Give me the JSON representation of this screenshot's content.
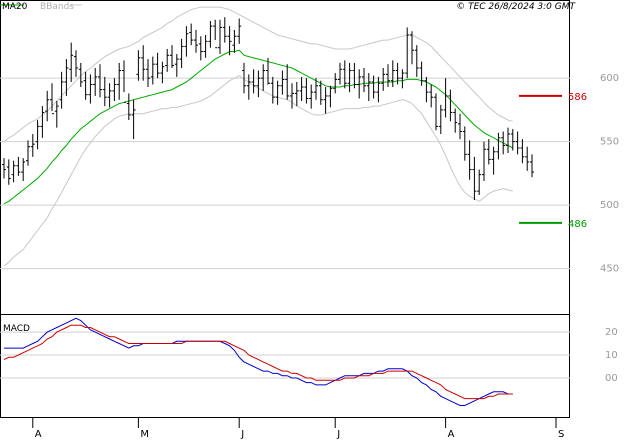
{
  "header": {
    "legend_ma": "MA20",
    "legend_bbands": "BBands",
    "copyright": "© TEC 26/8/2024 3:0 GMT"
  },
  "colors": {
    "ma": "#00aa00",
    "bbands": "#c8c8c8",
    "bars": "#000000",
    "grid": "#d0d0d0",
    "macd": "#0000cc",
    "signal": "#cc0000",
    "resistance": "#cc0000",
    "support": "#009900"
  },
  "chart_data": [
    {
      "type": "ohlc",
      "panel": "price",
      "ylim": [
        415,
        660
      ],
      "y_ticks": [
        450,
        500,
        550,
        600
      ],
      "x_ticks": [
        {
          "label": "A",
          "index": 6
        },
        {
          "label": "M",
          "index": 28
        },
        {
          "label": "J",
          "index": 49
        },
        {
          "label": "J",
          "index": 69
        },
        {
          "label": "A",
          "index": 92
        },
        {
          "label": "S",
          "index": 115
        }
      ],
      "levels": [
        {
          "name": "resistance",
          "value": 586,
          "label": "586"
        },
        {
          "name": "support",
          "value": 486,
          "label": "486"
        }
      ],
      "bars": [
        [
          532,
          537,
          521,
          528
        ],
        [
          530,
          536,
          516,
          521
        ],
        [
          524,
          535,
          518,
          531
        ],
        [
          531,
          538,
          523,
          526
        ],
        [
          526,
          537,
          519,
          534
        ],
        [
          535,
          551,
          531,
          546
        ],
        [
          546,
          556,
          538,
          548
        ],
        [
          550,
          567,
          544,
          562
        ],
        [
          562,
          578,
          553,
          573
        ],
        [
          574,
          590,
          566,
          583
        ],
        [
          583,
          596,
          574,
          572
        ],
        [
          574,
          582,
          561,
          578
        ],
        [
          583,
          605,
          576,
          597
        ],
        [
          597,
          615,
          586,
          608
        ],
        [
          607,
          628,
          597,
          618
        ],
        [
          617,
          622,
          601,
          608
        ],
        [
          607,
          612,
          593,
          597
        ],
        [
          598,
          605,
          583,
          587
        ],
        [
          587,
          603,
          580,
          595
        ],
        [
          595,
          608,
          586,
          601
        ],
        [
          601,
          611,
          585,
          591
        ],
        [
          591,
          601,
          578,
          585
        ],
        [
          585,
          596,
          577,
          590
        ],
        [
          590,
          600,
          582,
          595
        ],
        [
          595,
          612,
          583,
          606
        ],
        [
          606,
          614,
          589,
          581
        ],
        [
          580,
          588,
          567,
          571
        ],
        [
          571,
          583,
          552,
          575
        ],
        [
          603,
          622,
          598,
          616
        ],
        [
          616,
          626,
          598,
          607
        ],
        [
          607,
          615,
          593,
          600
        ],
        [
          601,
          617,
          595,
          611
        ],
        [
          611,
          620,
          600,
          604
        ],
        [
          604,
          613,
          596,
          609
        ],
        [
          610,
          623,
          605,
          618
        ],
        [
          618,
          626,
          608,
          610
        ],
        [
          611,
          619,
          601,
          615
        ],
        [
          615,
          631,
          608,
          625
        ],
        [
          625,
          641,
          617,
          635
        ],
        [
          636,
          643,
          626,
          630
        ],
        [
          630,
          638,
          620,
          626
        ],
        [
          627,
          633,
          614,
          621
        ],
        [
          621,
          634,
          616,
          629
        ],
        [
          629,
          645,
          624,
          641
        ],
        [
          641,
          646,
          630,
          624
        ],
        [
          624,
          646,
          619,
          640
        ],
        [
          640,
          648,
          628,
          633
        ],
        [
          633,
          641,
          618,
          629
        ],
        [
          626,
          638,
          620,
          633
        ],
        [
          633,
          647,
          627,
          641
        ],
        [
          606,
          612,
          588,
          594
        ],
        [
          594,
          603,
          583,
          597
        ],
        [
          597,
          607,
          588,
          594
        ],
        [
          594,
          606,
          585,
          600
        ],
        [
          600,
          611,
          590,
          606
        ],
        [
          606,
          616,
          595,
          596
        ],
        [
          596,
          601,
          580,
          585
        ],
        [
          585,
          598,
          579,
          594
        ],
        [
          594,
          606,
          587,
          599
        ],
        [
          599,
          611,
          583,
          586
        ],
        [
          586,
          596,
          576,
          588
        ],
        [
          588,
          597,
          578,
          590
        ],
        [
          590,
          601,
          582,
          593
        ],
        [
          593,
          600,
          580,
          584
        ],
        [
          584,
          595,
          576,
          589
        ],
        [
          589,
          600,
          583,
          594
        ],
        [
          594,
          598,
          579,
          583
        ],
        [
          583,
          593,
          572,
          586
        ],
        [
          586,
          594,
          577,
          592
        ],
        [
          592,
          604,
          588,
          599
        ],
        [
          599,
          612,
          595,
          607
        ],
        [
          607,
          614,
          592,
          596
        ],
        [
          596,
          612,
          589,
          606
        ],
        [
          606,
          612,
          592,
          595
        ],
        [
          595,
          607,
          584,
          601
        ],
        [
          601,
          608,
          589,
          594
        ],
        [
          594,
          604,
          582,
          597
        ],
        [
          597,
          602,
          584,
          589
        ],
        [
          589,
          601,
          581,
          596
        ],
        [
          596,
          608,
          590,
          603
        ],
        [
          603,
          611,
          593,
          598
        ],
        [
          598,
          614,
          593,
          606
        ],
        [
          606,
          612,
          595,
          600
        ],
        [
          600,
          607,
          592,
          604
        ],
        [
          604,
          640,
          600,
          634
        ],
        [
          634,
          637,
          611,
          622
        ],
        [
          622,
          626,
          601,
          608
        ],
        [
          608,
          613,
          594,
          598
        ],
        [
          598,
          601,
          581,
          589
        ],
        [
          589,
          595,
          577,
          585
        ],
        [
          585,
          588,
          559,
          562
        ],
        [
          562,
          579,
          556,
          575
        ],
        [
          575,
          600,
          569,
          586
        ],
        [
          586,
          591,
          566,
          573
        ],
        [
          573,
          576,
          557,
          565
        ],
        [
          564,
          572,
          552,
          558
        ],
        [
          558,
          562,
          535,
          540
        ],
        [
          540,
          551,
          520,
          528
        ],
        [
          528,
          538,
          504,
          511
        ],
        [
          511,
          528,
          508,
          524
        ],
        [
          524,
          550,
          519,
          544
        ],
        [
          544,
          552,
          532,
          536
        ],
        [
          536,
          546,
          524,
          542
        ],
        [
          542,
          557,
          536,
          553
        ],
        [
          553,
          558,
          540,
          547
        ],
        [
          547,
          561,
          541,
          556
        ],
        [
          556,
          560,
          543,
          550
        ],
        [
          550,
          558,
          540,
          545
        ],
        [
          545,
          552,
          533,
          538
        ],
        [
          538,
          546,
          527,
          534
        ],
        [
          534,
          540,
          522,
          526
        ]
      ],
      "series": [
        {
          "name": "MA20",
          "values": [
            501,
            503,
            506,
            509,
            512,
            515,
            518,
            521,
            525,
            529,
            534,
            538,
            543,
            547,
            552,
            556,
            560,
            563,
            566,
            569,
            572,
            574,
            576,
            578,
            580,
            581,
            582,
            583,
            584,
            585,
            586,
            587,
            588,
            589,
            590,
            591,
            593,
            595,
            597,
            600,
            603,
            606,
            609,
            612,
            615,
            617,
            619,
            621,
            621,
            622,
            618,
            617,
            616,
            615,
            614,
            613,
            612,
            611,
            610,
            609,
            608,
            606,
            604,
            602,
            600,
            598,
            596,
            594,
            593,
            593,
            593,
            594,
            594,
            595,
            595,
            596,
            596,
            596,
            597,
            597,
            597,
            597,
            598,
            598,
            599,
            599,
            599,
            598,
            597,
            595,
            593,
            590,
            587,
            583,
            579,
            575,
            571,
            567,
            563,
            560,
            557,
            555,
            553,
            551,
            549,
            547,
            545
          ]
        },
        {
          "name": "BBands",
          "values": [
            452,
            455,
            459,
            462,
            465,
            470,
            475,
            480,
            485,
            490,
            497,
            503,
            510,
            517,
            524,
            531,
            538,
            544,
            549,
            554,
            558,
            562,
            565,
            568,
            570,
            571,
            572,
            572,
            572,
            572,
            573,
            574,
            575,
            576,
            576,
            577,
            577,
            578,
            579,
            580,
            581,
            582,
            584,
            586,
            589,
            592,
            595,
            598,
            600,
            602,
            599,
            597,
            594,
            592,
            590,
            588,
            586,
            585,
            584,
            583,
            581,
            578,
            576,
            574,
            572,
            571,
            571,
            572,
            573,
            574,
            575,
            576,
            576,
            576,
            576,
            577,
            577,
            578,
            578,
            579,
            580,
            581,
            582,
            583,
            582,
            580,
            576,
            572,
            566,
            560,
            554,
            547,
            539,
            530,
            522,
            515,
            510,
            507,
            505,
            503,
            506,
            509,
            511,
            512,
            513,
            512,
            511
          ]
        },
        {
          "name": "BBands",
          "values": [
            550,
            553,
            555,
            558,
            561,
            564,
            566,
            568,
            571,
            574,
            578,
            582,
            586,
            590,
            594,
            598,
            602,
            605,
            608,
            611,
            614,
            617,
            619,
            621,
            623,
            624,
            625,
            627,
            629,
            632,
            634,
            636,
            638,
            640,
            643,
            645,
            648,
            650,
            652,
            654,
            655,
            656,
            656,
            656,
            656,
            656,
            655,
            654,
            652,
            650,
            648,
            646,
            644,
            642,
            640,
            638,
            636,
            634,
            633,
            632,
            631,
            630,
            629,
            628,
            627,
            627,
            626,
            625,
            624,
            623,
            623,
            623,
            623,
            624,
            625,
            626,
            627,
            628,
            629,
            630,
            630,
            631,
            632,
            633,
            634,
            634,
            632,
            630,
            628,
            625,
            621,
            617,
            613,
            609,
            605,
            601,
            597,
            593,
            589,
            585,
            581,
            577,
            574,
            571,
            569,
            567,
            566
          ]
        }
      ]
    },
    {
      "type": "line",
      "panel": "macd",
      "title": "MACD",
      "y_ticks": [
        {
          "label": "20",
          "value": 20
        },
        {
          "label": "10",
          "value": 10
        },
        {
          "label": "00",
          "value": 0
        }
      ],
      "ylim": [
        -17,
        27
      ],
      "series": [
        {
          "name": "MACD",
          "values": [
            13,
            13,
            13,
            13,
            13,
            14,
            15,
            16,
            18,
            20,
            21,
            22,
            23,
            24,
            25,
            26,
            25,
            23,
            21,
            20,
            19,
            18,
            17,
            16,
            15,
            14,
            13,
            14,
            14,
            15,
            15,
            15,
            15,
            15,
            15,
            15,
            16,
            16,
            16,
            16,
            16,
            16,
            16,
            16,
            16,
            16,
            15,
            14,
            12,
            9,
            7,
            6,
            5,
            4,
            3,
            3,
            2,
            2,
            1,
            1,
            0,
            0,
            -1,
            -2,
            -2,
            -3,
            -3,
            -3,
            -2,
            -1,
            0,
            1,
            1,
            1,
            1,
            2,
            2,
            2,
            3,
            3,
            4,
            4,
            4,
            4,
            3,
            1,
            0,
            -2,
            -3,
            -5,
            -6,
            -8,
            -9,
            -10,
            -11,
            -12,
            -12,
            -11,
            -10,
            -9,
            -8,
            -7,
            -6,
            -6,
            -6,
            -7,
            -7
          ]
        },
        {
          "name": "Signal",
          "values": [
            8,
            9,
            9,
            10,
            11,
            12,
            13,
            14,
            15,
            17,
            18,
            20,
            21,
            22,
            23,
            23,
            23,
            22,
            22,
            21,
            20,
            19,
            18,
            18,
            17,
            16,
            15,
            15,
            15,
            15,
            15,
            15,
            15,
            15,
            15,
            15,
            15,
            15,
            16,
            16,
            16,
            16,
            16,
            16,
            16,
            16,
            16,
            15,
            14,
            13,
            12,
            10,
            9,
            8,
            7,
            6,
            5,
            4,
            3,
            3,
            2,
            2,
            1,
            0,
            0,
            -1,
            -1,
            -1,
            -1,
            -1,
            -1,
            0,
            0,
            0,
            1,
            1,
            1,
            2,
            2,
            2,
            3,
            3,
            3,
            3,
            3,
            3,
            2,
            1,
            0,
            -1,
            -2,
            -3,
            -5,
            -6,
            -7,
            -8,
            -9,
            -9,
            -9,
            -9,
            -9,
            -8,
            -8,
            -7,
            -7,
            -7,
            -7
          ]
        }
      ]
    }
  ]
}
